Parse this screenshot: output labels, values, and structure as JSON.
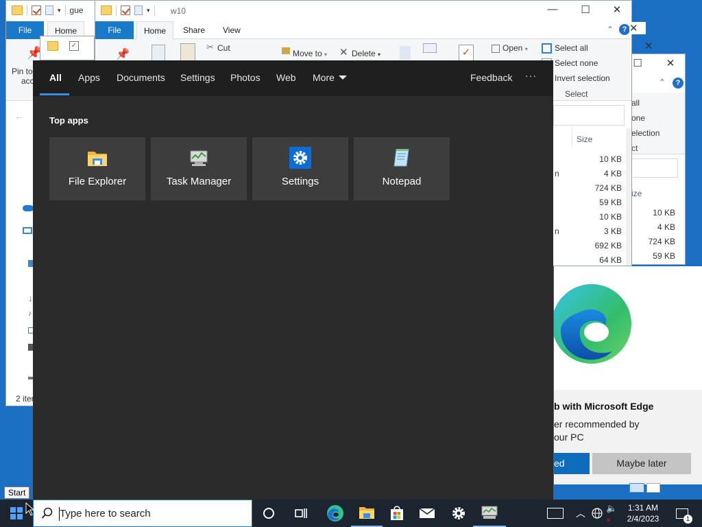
{
  "desktop": {
    "background": "#1a6fc4"
  },
  "explorer_left": {
    "tab_file": "File",
    "tab_home": "Home",
    "title_fragment": "gue",
    "pin_label_line1": "Pin to",
    "pin_label_line2": "acc",
    "status_items": "2 iter"
  },
  "explorer_w10": {
    "title": "w10",
    "tabs": [
      "File",
      "Home",
      "Share",
      "View"
    ],
    "ribbon": {
      "cut": "Cut",
      "move_to": "Move to",
      "delete": "Delete",
      "open": "Open",
      "select_all": "Select all",
      "select_none": "Select none",
      "invert_selection": "Invert selection",
      "group_select": "Select"
    },
    "column_size": "Size",
    "sizes": [
      "10 KB",
      "4 KB",
      "724 KB",
      "59 KB",
      "10 KB",
      "3 KB",
      "692 KB",
      "64 KB"
    ],
    "name_fragments": [
      "n",
      "n"
    ]
  },
  "explorer_back": {
    "ribbon_all": "all",
    "ribbon_none": "one",
    "ribbon_selection": "election",
    "ribbon_group": "ct",
    "column_size": "ize",
    "sizes": [
      "10 KB",
      "4 KB",
      "724 KB",
      "59 KB"
    ]
  },
  "search_panel": {
    "tabs": [
      "All",
      "Apps",
      "Documents",
      "Settings",
      "Photos",
      "Web",
      "More"
    ],
    "feedback": "Feedback",
    "overflow": "···",
    "section_title": "Top apps",
    "top_apps": [
      {
        "label": "File Explorer",
        "icon": "file-explorer-icon"
      },
      {
        "label": "Task Manager",
        "icon": "task-manager-icon"
      },
      {
        "label": "Settings",
        "icon": "settings-gear-icon"
      },
      {
        "label": "Notepad",
        "icon": "notepad-icon"
      }
    ]
  },
  "edge_promo": {
    "title": "b with Microsoft Edge",
    "line1": "er recommended by",
    "line2": "our PC",
    "primary_button": "ed",
    "secondary_button": "Maybe later",
    "primary_color": "#0f6cbd"
  },
  "start_tooltip": "Start",
  "taskbar": {
    "search_placeholder": "Type here to search",
    "pinned": [
      "cortana-icon",
      "task-view-icon",
      "edge-icon",
      "file-explorer-icon",
      "microsoft-store-icon",
      "mail-icon",
      "settings-gear-icon",
      "task-manager-icon"
    ],
    "clock_time": "1:31 AM",
    "clock_date": "2/4/2023",
    "notification_count": "1"
  }
}
